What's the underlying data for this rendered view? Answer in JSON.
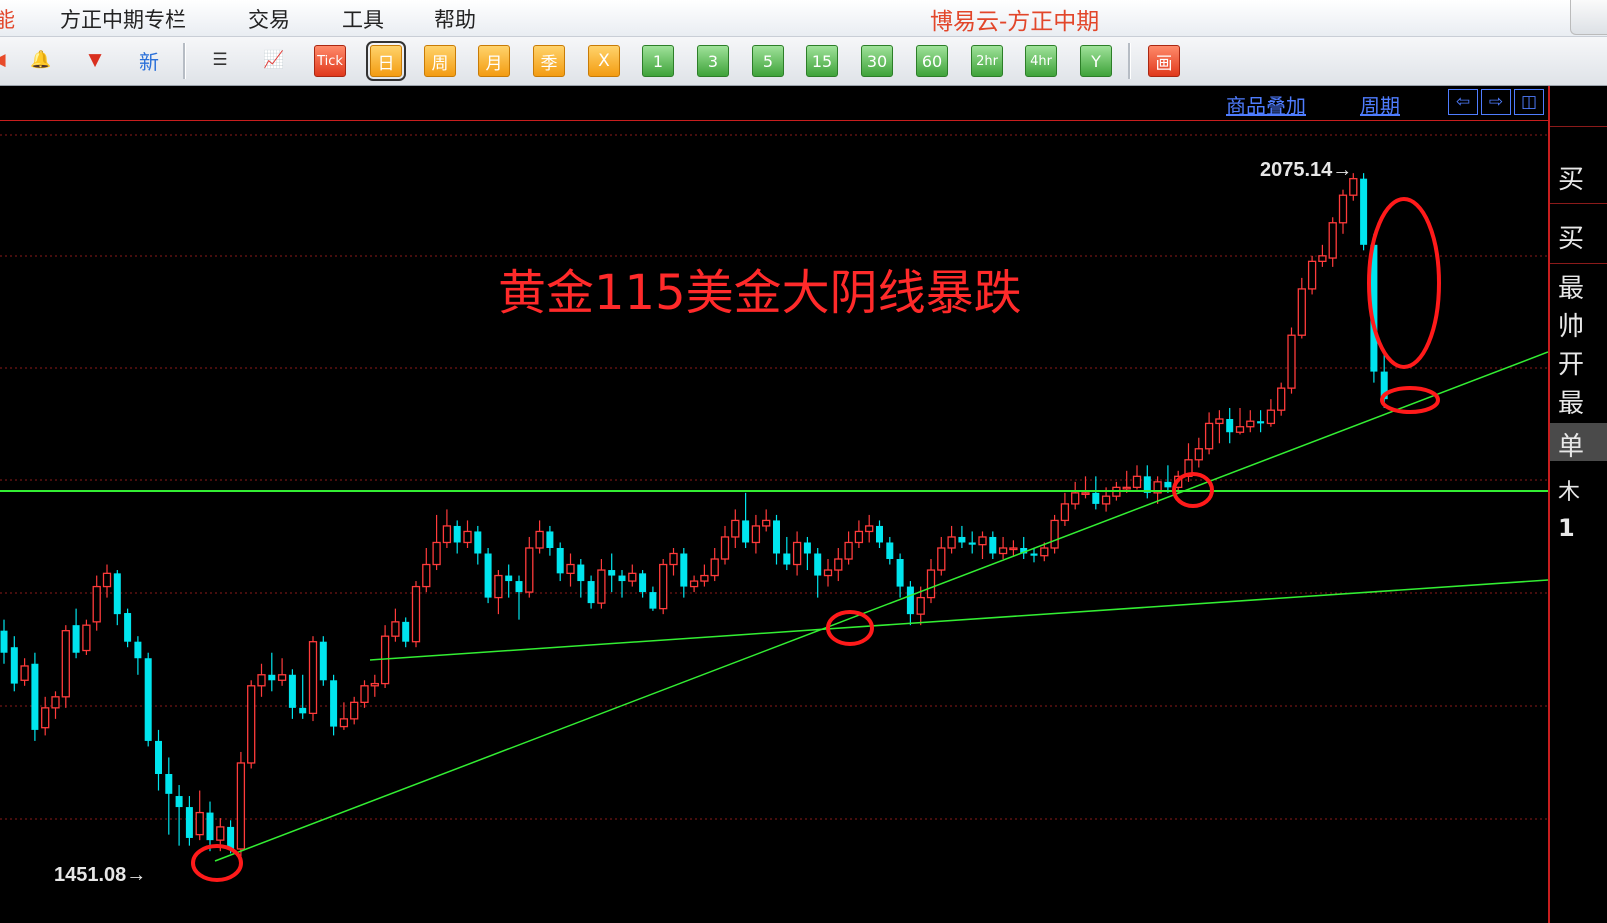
{
  "menubar": {
    "left_fragment": "能",
    "items": [
      "方正中期专栏",
      "交易",
      "工具",
      "帮助"
    ],
    "app_title": "博易云-方正中期"
  },
  "toolbar": {
    "periods": [
      "日",
      "周",
      "月",
      "季",
      "X",
      "1",
      "3",
      "5",
      "15",
      "30",
      "60",
      "2hr",
      "4hr",
      "Y"
    ],
    "selected_period": "日",
    "tick_label": "Tick",
    "draw_label": "画",
    "new_label": "新"
  },
  "chart_header": {
    "overlay_link": "商品叠加",
    "period_link": "周期",
    "nav_left": "⇦",
    "nav_right": "⇨",
    "nav_layout": "◫"
  },
  "right_panel": {
    "labels": [
      "买",
      "买",
      "最",
      "帅",
      "开",
      "最",
      "单",
      "木",
      "1"
    ],
    "selected_index": 6
  },
  "annotation": "黄金115美金大阴线暴跌",
  "extremes": {
    "high_label": "2075.14→",
    "low_label": "1451.08→"
  },
  "colors": {
    "up": "#ff3b3b",
    "down": "#00e5ee",
    "trendline": "#33ee33",
    "circle": "#ff1a1a",
    "grid": "#8b1a1a"
  },
  "chart_data": {
    "type": "candlestick",
    "symbol": "gold",
    "y_high": 2075.14,
    "y_low": 1451.08,
    "candles": [
      [
        1660,
        1640,
        1670,
        1630
      ],
      [
        1645,
        1612,
        1655,
        1605
      ],
      [
        1615,
        1628,
        1635,
        1610
      ],
      [
        1630,
        1570,
        1640,
        1560
      ],
      [
        1572,
        1590,
        1600,
        1565
      ],
      [
        1590,
        1600,
        1605,
        1580
      ],
      [
        1600,
        1660,
        1665,
        1590
      ],
      [
        1665,
        1640,
        1680,
        1635
      ],
      [
        1642,
        1665,
        1670,
        1638
      ],
      [
        1668,
        1700,
        1710,
        1660
      ],
      [
        1700,
        1712,
        1720,
        1690
      ],
      [
        1712,
        1675,
        1715,
        1665
      ],
      [
        1676,
        1650,
        1680,
        1645
      ],
      [
        1650,
        1635,
        1655,
        1620
      ],
      [
        1635,
        1560,
        1640,
        1555
      ],
      [
        1560,
        1530,
        1570,
        1515
      ],
      [
        1530,
        1512,
        1545,
        1475
      ],
      [
        1510,
        1500,
        1520,
        1465
      ],
      [
        1500,
        1472,
        1510,
        1465
      ],
      [
        1475,
        1495,
        1515,
        1470
      ],
      [
        1495,
        1470,
        1505,
        1460
      ],
      [
        1470,
        1482,
        1490,
        1460
      ],
      [
        1482,
        1462,
        1488,
        1458
      ],
      [
        1462,
        1540,
        1550,
        1455
      ],
      [
        1540,
        1610,
        1615,
        1535
      ],
      [
        1610,
        1620,
        1630,
        1600
      ],
      [
        1620,
        1615,
        1640,
        1605
      ],
      [
        1615,
        1620,
        1635,
        1610
      ],
      [
        1620,
        1590,
        1625,
        1580
      ],
      [
        1590,
        1585,
        1620,
        1580
      ],
      [
        1585,
        1650,
        1655,
        1578
      ],
      [
        1650,
        1615,
        1655,
        1610
      ],
      [
        1615,
        1573,
        1620,
        1565
      ],
      [
        1573,
        1580,
        1595,
        1570
      ],
      [
        1580,
        1595,
        1600,
        1575
      ],
      [
        1595,
        1610,
        1615,
        1590
      ],
      [
        1610,
        1612,
        1620,
        1600
      ],
      [
        1612,
        1655,
        1665,
        1608
      ],
      [
        1655,
        1668,
        1680,
        1650
      ],
      [
        1668,
        1650,
        1672,
        1645
      ],
      [
        1650,
        1700,
        1705,
        1645
      ],
      [
        1700,
        1720,
        1735,
        1695
      ],
      [
        1720,
        1740,
        1765,
        1715
      ],
      [
        1740,
        1755,
        1770,
        1735
      ],
      [
        1755,
        1740,
        1760,
        1730
      ],
      [
        1740,
        1750,
        1760,
        1735
      ],
      [
        1750,
        1730,
        1755,
        1720
      ],
      [
        1730,
        1690,
        1735,
        1685
      ],
      [
        1690,
        1710,
        1715,
        1675
      ],
      [
        1710,
        1705,
        1720,
        1690
      ],
      [
        1705,
        1695,
        1710,
        1670
      ],
      [
        1695,
        1735,
        1745,
        1690
      ],
      [
        1735,
        1750,
        1760,
        1730
      ],
      [
        1750,
        1735,
        1755,
        1728
      ],
      [
        1735,
        1712,
        1740,
        1705
      ],
      [
        1712,
        1720,
        1730,
        1700
      ],
      [
        1720,
        1705,
        1725,
        1690
      ],
      [
        1705,
        1685,
        1710,
        1680
      ],
      [
        1685,
        1715,
        1725,
        1680
      ],
      [
        1715,
        1710,
        1730,
        1695
      ],
      [
        1710,
        1705,
        1715,
        1690
      ],
      [
        1705,
        1712,
        1720,
        1700
      ],
      [
        1712,
        1695,
        1715,
        1690
      ],
      [
        1695,
        1680,
        1700,
        1678
      ],
      [
        1680,
        1720,
        1725,
        1675
      ],
      [
        1720,
        1730,
        1735,
        1710
      ],
      [
        1730,
        1700,
        1735,
        1690
      ],
      [
        1700,
        1705,
        1710,
        1695
      ],
      [
        1705,
        1710,
        1720,
        1700
      ],
      [
        1710,
        1725,
        1735,
        1705
      ],
      [
        1725,
        1745,
        1755,
        1720
      ],
      [
        1745,
        1760,
        1770,
        1735
      ],
      [
        1760,
        1740,
        1785,
        1735
      ],
      [
        1740,
        1755,
        1765,
        1730
      ],
      [
        1755,
        1760,
        1770,
        1750
      ],
      [
        1760,
        1730,
        1765,
        1720
      ],
      [
        1730,
        1720,
        1745,
        1715
      ],
      [
        1720,
        1740,
        1750,
        1710
      ],
      [
        1740,
        1730,
        1745,
        1715
      ],
      [
        1730,
        1710,
        1735,
        1690
      ],
      [
        1710,
        1715,
        1725,
        1700
      ],
      [
        1715,
        1725,
        1735,
        1705
      ],
      [
        1725,
        1740,
        1750,
        1720
      ],
      [
        1740,
        1750,
        1760,
        1735
      ],
      [
        1750,
        1755,
        1765,
        1740
      ],
      [
        1755,
        1740,
        1760,
        1735
      ],
      [
        1740,
        1725,
        1745,
        1720
      ],
      [
        1725,
        1700,
        1730,
        1690
      ],
      [
        1700,
        1675,
        1705,
        1665
      ],
      [
        1675,
        1690,
        1700,
        1665
      ],
      [
        1690,
        1715,
        1725,
        1685
      ],
      [
        1715,
        1735,
        1745,
        1710
      ],
      [
        1735,
        1745,
        1755,
        1730
      ],
      [
        1745,
        1740,
        1755,
        1735
      ],
      [
        1740,
        1738,
        1750,
        1730
      ],
      [
        1738,
        1745,
        1750,
        1725
      ],
      [
        1745,
        1730,
        1750,
        1725
      ],
      [
        1730,
        1735,
        1745,
        1725
      ],
      [
        1735,
        1735,
        1742,
        1728
      ],
      [
        1735,
        1730,
        1745,
        1725
      ],
      [
        1730,
        1728,
        1735,
        1722
      ],
      [
        1728,
        1735,
        1740,
        1723
      ],
      [
        1735,
        1760,
        1765,
        1730
      ],
      [
        1760,
        1775,
        1785,
        1755
      ],
      [
        1775,
        1785,
        1795,
        1770
      ],
      [
        1785,
        1785,
        1800,
        1780
      ],
      [
        1785,
        1775,
        1800,
        1770
      ],
      [
        1775,
        1782,
        1790,
        1768
      ],
      [
        1782,
        1790,
        1795,
        1778
      ],
      [
        1790,
        1790,
        1805,
        1785
      ],
      [
        1790,
        1800,
        1810,
        1788
      ],
      [
        1800,
        1785,
        1810,
        1780
      ],
      [
        1785,
        1795,
        1800,
        1775
      ],
      [
        1795,
        1790,
        1810,
        1785
      ],
      [
        1790,
        1800,
        1805,
        1785
      ],
      [
        1800,
        1815,
        1830,
        1795
      ],
      [
        1815,
        1825,
        1835,
        1808
      ],
      [
        1825,
        1848,
        1858,
        1820
      ],
      [
        1848,
        1852,
        1860,
        1830
      ],
      [
        1852,
        1840,
        1862,
        1830
      ],
      [
        1840,
        1845,
        1862,
        1838
      ],
      [
        1845,
        1850,
        1860,
        1840
      ],
      [
        1850,
        1848,
        1860,
        1840
      ],
      [
        1848,
        1860,
        1870,
        1845
      ],
      [
        1860,
        1880,
        1885,
        1855
      ],
      [
        1880,
        1928,
        1935,
        1875
      ],
      [
        1928,
        1970,
        1980,
        1925
      ],
      [
        1970,
        1995,
        2000,
        1965
      ],
      [
        1995,
        2000,
        2010,
        1990
      ],
      [
        1998,
        2030,
        2035,
        1990
      ],
      [
        2030,
        2055,
        2060,
        2020
      ],
      [
        2055,
        2070,
        2075,
        2050
      ],
      [
        2070,
        2010,
        2075,
        2005
      ],
      [
        2010,
        1895,
        2020,
        1885
      ],
      [
        1895,
        1870,
        1912,
        1862
      ]
    ]
  }
}
